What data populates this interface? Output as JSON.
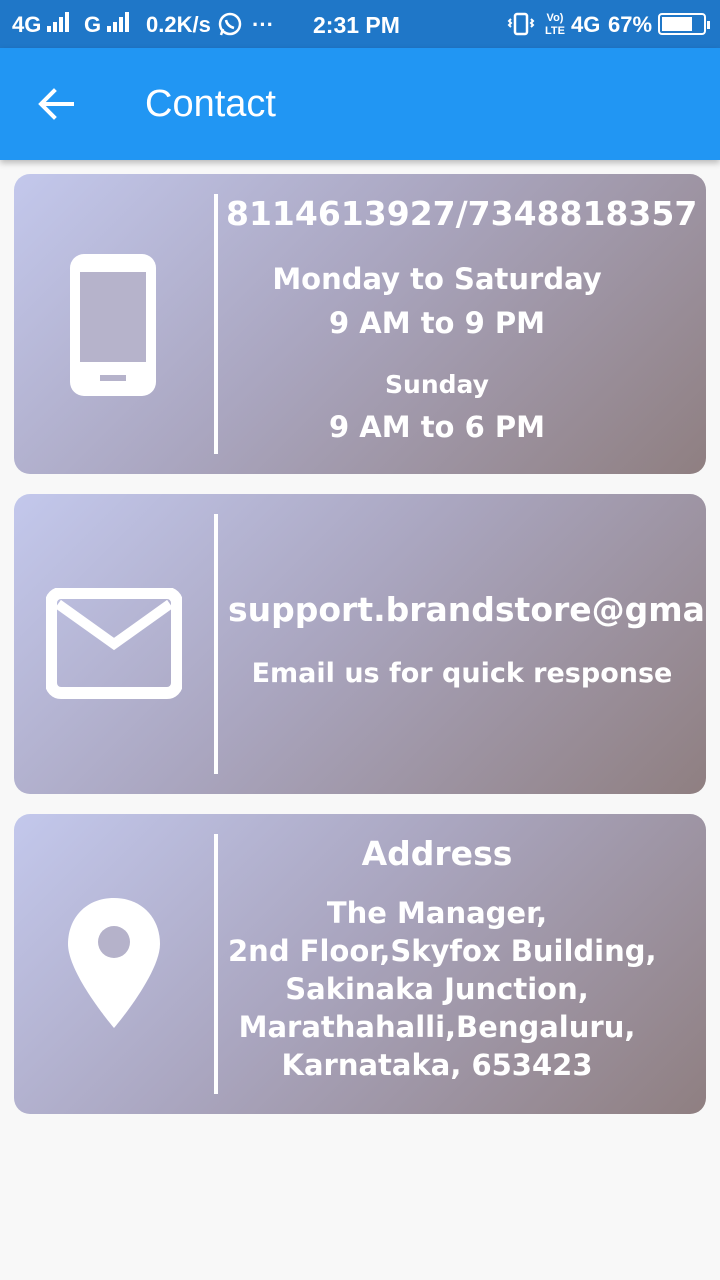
{
  "status_bar": {
    "network_left": "4G",
    "network_mid": "G",
    "speed": "0.2K/s",
    "more": "···",
    "time": "2:31 PM",
    "lte": "Vo) LTE",
    "network_right": "4G",
    "battery": "67%",
    "icons": [
      "whatsapp-icon",
      "vibrate-icon",
      "battery-charging-icon"
    ]
  },
  "app_bar": {
    "title": "Contact",
    "back_icon": "arrow-left-icon",
    "color": "#2196f3"
  },
  "cards": {
    "phone": {
      "icon": "phone-icon",
      "number": "8114613927/7348818357",
      "weekday_label": "Monday to Saturday",
      "weekday_hours": "9 AM to 9 PM",
      "sunday_label": "Sunday",
      "sunday_hours": "9 AM to 6 PM"
    },
    "email": {
      "icon": "mail-icon",
      "address": "support.brandstore@gmail.com",
      "note": "Email us for quick response"
    },
    "address": {
      "icon": "location-pin-icon",
      "heading": "Address",
      "lines": [
        "The Manager,",
        "2nd Floor,Skyfox Building,",
        "Sakinaka Junction,",
        "Marathahalli,Bengaluru,",
        "Karnataka, 653423"
      ]
    }
  }
}
